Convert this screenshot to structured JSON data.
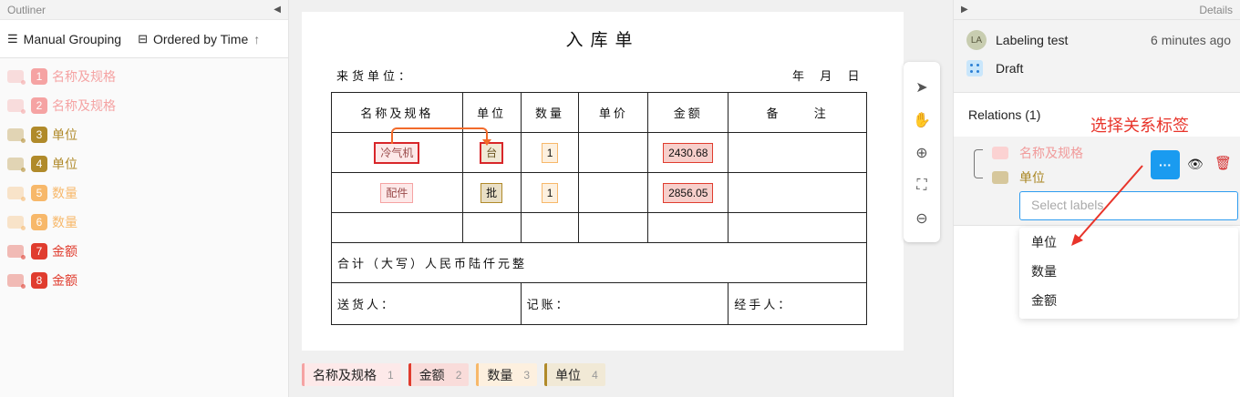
{
  "outliner": {
    "title": "Outliner",
    "grouping_label": "Manual Grouping",
    "order_label": "Ordered by Time",
    "items": [
      {
        "index": "1",
        "label": "名称及规格",
        "color": "#f5a3a3"
      },
      {
        "index": "2",
        "label": "名称及规格",
        "color": "#f5a3a3"
      },
      {
        "index": "3",
        "label": "单位",
        "color": "#b08a2a"
      },
      {
        "index": "4",
        "label": "单位",
        "color": "#b08a2a"
      },
      {
        "index": "5",
        "label": "数量",
        "color": "#f7b86a"
      },
      {
        "index": "6",
        "label": "数量",
        "color": "#f7b86a"
      },
      {
        "index": "7",
        "label": "金额",
        "color": "#e03c2e"
      },
      {
        "index": "8",
        "label": "金额",
        "color": "#e03c2e"
      }
    ]
  },
  "document": {
    "title": "入库单",
    "supplier_label": "来货单位：",
    "date_label": "年 月 日",
    "headers": [
      "名称及规格",
      "单位",
      "数量",
      "单价",
      "金额",
      "备 注"
    ],
    "rows": [
      {
        "name": "冷气机",
        "unit": "台",
        "qty": "1",
        "amount": "2430.68"
      },
      {
        "name": "配件",
        "unit": "批",
        "qty": "1",
        "amount": "2856.05"
      }
    ],
    "total_label": "合计（大写）人民币陆仟元整",
    "deliverer_label": "送货人：",
    "bookkeeper_label": "记账：",
    "handler_label": "经手人："
  },
  "label_chips": [
    {
      "label": "名称及规格",
      "count": "1",
      "color": "#f5a3a3",
      "bg": "#fde9e9"
    },
    {
      "label": "金额",
      "count": "2",
      "color": "#e03c2e",
      "bg": "#f9dcda"
    },
    {
      "label": "数量",
      "count": "3",
      "color": "#f7b86a",
      "bg": "#fdf0df"
    },
    {
      "label": "单位",
      "count": "4",
      "color": "#b08a2a",
      "bg": "#f1e9d6"
    }
  ],
  "details": {
    "title": "Details",
    "avatar": "LA",
    "annotation_name": "Labeling test",
    "time": "6 minutes ago",
    "status": "Draft",
    "relations_title": "Relations (1)",
    "note": "选择关系标签",
    "relation_from": "名称及规格",
    "relation_to": "单位",
    "more_button": "···",
    "select_placeholder": "Select labels",
    "options": [
      "单位",
      "数量",
      "金额"
    ]
  }
}
